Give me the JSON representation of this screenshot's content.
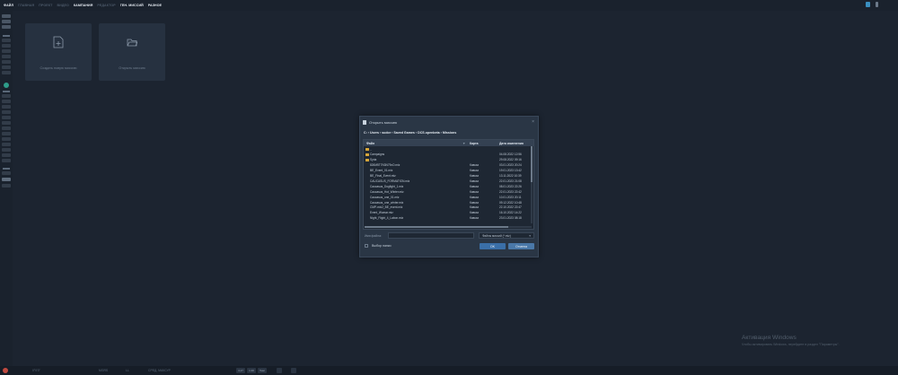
{
  "menu": [
    {
      "label": "ФАЙЛ",
      "active": true
    },
    {
      "label": "ГЛАВНАЯ",
      "active": false
    },
    {
      "label": "ПРОЕКТ",
      "active": false
    },
    {
      "label": "ВИДЕО",
      "active": false
    },
    {
      "label": "КАМПАНИЯ",
      "active": true
    },
    {
      "label": "РЕДАКТОР",
      "active": false
    },
    {
      "label": "ГЕН. МИССИЙ",
      "active": true
    },
    {
      "label": "РАЗНОЕ",
      "active": true
    }
  ],
  "cards": {
    "new_mission": "Создать новую миссию",
    "open_mission": "Открыть миссию"
  },
  "dialog": {
    "title": "Открыть миссию",
    "path": "C: › Users › sudor › Saved Games › DCS.openbeta › Missions",
    "columns": {
      "name": "Файл",
      "type": "Карта",
      "date": "Дата изменения"
    },
    "rows": [
      {
        "name": "..",
        "type": "",
        "date": "",
        "folder": true
      },
      {
        "name": "Campaigns",
        "type": "",
        "date": "04.08.2022 12:56",
        "folder": true
      },
      {
        "name": "Syria",
        "type": "",
        "date": "29.08.2022 09:16",
        "folder": true
      },
      {
        "name": "826M5T7N3N79xO.miz",
        "type": "Кавказ",
        "date": "03.01.2023 20:24",
        "folder": false
      },
      {
        "name": "BE_Event_01.miz",
        "type": "Кавказ",
        "date": "19.01.2023 13:42",
        "folder": false
      },
      {
        "name": "BE_Final_Event.miz",
        "type": "Кавказ",
        "date": "13.11.2022 10:39",
        "folder": false
      },
      {
        "name": "CAUCASUS_FORMATION.miz",
        "type": "Кавказ",
        "date": "22.01.2023 21:08",
        "folder": false
      },
      {
        "name": "Caucasus_Dogfight_1.miz",
        "type": "Кавказ",
        "date": "08.01.2023 22:26",
        "folder": false
      },
      {
        "name": "Caucasus_Hot_Winter.miz",
        "type": "Кавказ",
        "date": "22.01.2023 22:42",
        "folder": false
      },
      {
        "name": "Caucasus_one_01.miz",
        "type": "Кавказ",
        "date": "10.01.2023 20:11",
        "folder": false
      },
      {
        "name": "Caucasus_one_winter.miz",
        "type": "Кавказ",
        "date": "09.12.2022 10:48",
        "folder": false
      },
      {
        "name": "CMP-mix2_BE_event.miz",
        "type": "Кавказ",
        "date": "22.10.2022 22:47",
        "folder": false
      },
      {
        "name": "Event_Wumar.miz",
        "type": "Кавказ",
        "date": "16.10.2022 14:22",
        "folder": false
      },
      {
        "name": "Night_Flight_4_Labon.miz",
        "type": "Кавказ",
        "date": "23.01.2023 08:18",
        "folder": false
      }
    ],
    "filename_label": "Имя файла:",
    "filename_value": "",
    "filter": "Файлы миссий (*.miz)",
    "folder_choice": "Выбор папки",
    "ok": "OK",
    "cancel": "Отмена"
  },
  "watermark": {
    "line1": "Активация Windows",
    "line2": "Чтобы активировать Windows, перейдите в раздел \"Параметры\"."
  },
  "status": {
    "coord1": "0°0'0\"",
    "coord2": "MGRS",
    "coord3": "LL",
    "coord4": "СРЕД. МАКСУР",
    "zoom1": "4,17",
    "zoom2": "1:20",
    "zoom3": "5нм"
  },
  "colors": {
    "background": "#1c2430",
    "dialog": "#2a3645",
    "accent": "#3a6fa8",
    "folder": "#d6a63a"
  }
}
